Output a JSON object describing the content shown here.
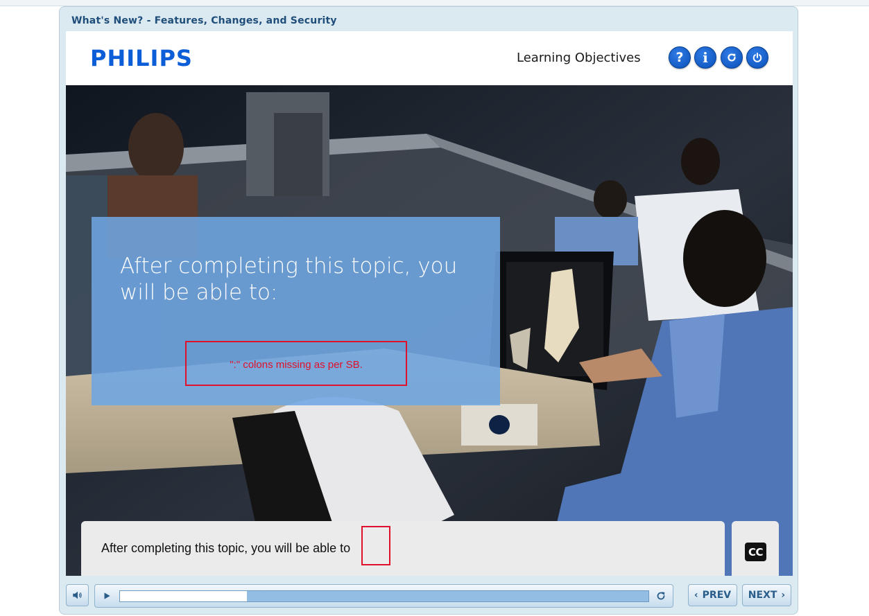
{
  "course": {
    "title": "What's New? - Features, Changes, and Security"
  },
  "header": {
    "logo_text": "PHILIPS",
    "section_title": "Learning Objectives",
    "buttons": [
      {
        "icon": "help-icon",
        "glyph": "?"
      },
      {
        "icon": "info-icon",
        "glyph": "i"
      },
      {
        "icon": "replay-icon",
        "glyph": ""
      },
      {
        "icon": "power-icon",
        "glyph": ""
      }
    ]
  },
  "slide": {
    "objective_text": "After completing this topic, you will be able to:",
    "annotation_text": "\":\" colons missing as per SB."
  },
  "caption": {
    "text": "After completing this topic, you will be able to",
    "cc_label": "CC"
  },
  "controls": {
    "progress": 0.24,
    "prev_label": "PREV",
    "next_label": "NEXT"
  },
  "colors": {
    "brand_blue": "#0b5ed7",
    "annotation_red": "#e0102a",
    "overlay_blue": "#6ea5e1"
  }
}
